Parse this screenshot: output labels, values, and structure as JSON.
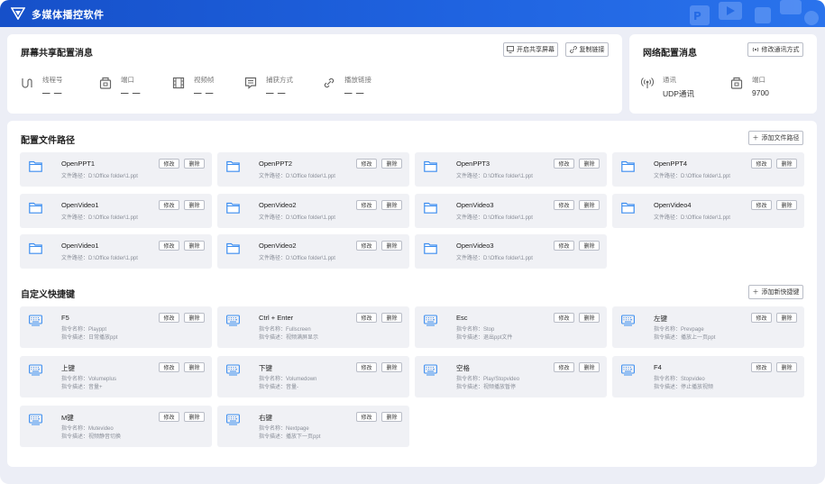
{
  "app": {
    "title": "多媒体播控软件"
  },
  "screen_share": {
    "title": "屏幕共享配置消息",
    "btn_start": "开启共享屏幕",
    "btn_copy": "复制链接",
    "fields": [
      {
        "icon": "thread-icon",
        "label": "线程号",
        "value": "— —"
      },
      {
        "icon": "port-icon",
        "label": "端口",
        "value": "— —"
      },
      {
        "icon": "video-frame-icon",
        "label": "视频帧",
        "value": "— —"
      },
      {
        "icon": "capture-icon",
        "label": "捕获方式",
        "value": "— —"
      },
      {
        "icon": "link-icon",
        "label": "播放链接",
        "value": "— —"
      }
    ]
  },
  "network": {
    "title": "网络配置消息",
    "btn_change": "修改通讯方式",
    "fields": [
      {
        "icon": "signal-icon",
        "label": "通讯",
        "value": "UDP通讯"
      },
      {
        "icon": "port-icon",
        "label": "端口",
        "value": "9700"
      }
    ]
  },
  "paths": {
    "title": "配置文件路径",
    "btn_add": "添加文件路径",
    "path_prefix": "文件路径：",
    "edit": "修改",
    "delete": "删除",
    "items": [
      {
        "name": "OpenPPT1",
        "path": "D:\\Office folder\\1.ppt"
      },
      {
        "name": "OpenPPT2",
        "path": "D:\\Office folder\\1.ppt"
      },
      {
        "name": "OpenPPT3",
        "path": "D:\\Office folder\\1.ppt"
      },
      {
        "name": "OpenPPT4",
        "path": "D:\\Office folder\\1.ppt"
      },
      {
        "name": "OpenVideo1",
        "path": "D:\\Office folder\\1.ppt"
      },
      {
        "name": "OpenVideo2",
        "path": "D:\\Office folder\\1.ppt"
      },
      {
        "name": "OpenVideo3",
        "path": "D:\\Office folder\\1.ppt"
      },
      {
        "name": "OpenVideo4",
        "path": "D:\\Office folder\\1.ppt"
      },
      {
        "name": "OpenVideo1",
        "path": "D:\\Office folder\\1.ppt"
      },
      {
        "name": "OpenVideo2",
        "path": "D:\\Office folder\\1.ppt"
      },
      {
        "name": "OpenVideo3",
        "path": "D:\\Office folder\\1.ppt"
      }
    ]
  },
  "hotkeys": {
    "title": "自定义快捷键",
    "btn_add": "添加新快捷键",
    "name_prefix": "指令名称：",
    "desc_prefix": "指令描述：",
    "edit": "修改",
    "delete": "删除",
    "items": [
      {
        "key": "F5",
        "name": "Playppt",
        "desc": "日常播放ppt"
      },
      {
        "key": "Ctrl + Enter",
        "name": "Fullscreen",
        "desc": "视频满屏显示"
      },
      {
        "key": "Esc",
        "name": "Stop",
        "desc": "退出ppt文件"
      },
      {
        "key": "左键",
        "name": "Prevpage",
        "desc": "播放上一页ppt"
      },
      {
        "key": "上键",
        "name": "Volumeplus",
        "desc": "音量+"
      },
      {
        "key": "下键",
        "name": "Volumedown",
        "desc": "音量-"
      },
      {
        "key": "空格",
        "name": "Play/Stopvideo",
        "desc": "视频播放暂停"
      },
      {
        "key": "F4",
        "name": "Stopvideo",
        "desc": "停止播放视频"
      },
      {
        "key": "M键",
        "name": "Mutevideo",
        "desc": "视频静音切换"
      },
      {
        "key": "右键",
        "name": "Nextpage",
        "desc": "播放下一页ppt"
      }
    ]
  },
  "colors": {
    "accent": "#1f63e0",
    "folder": "#3d8ef0",
    "keyboard": "#3d8ef0",
    "tile_bg": "#f0f1f5"
  }
}
